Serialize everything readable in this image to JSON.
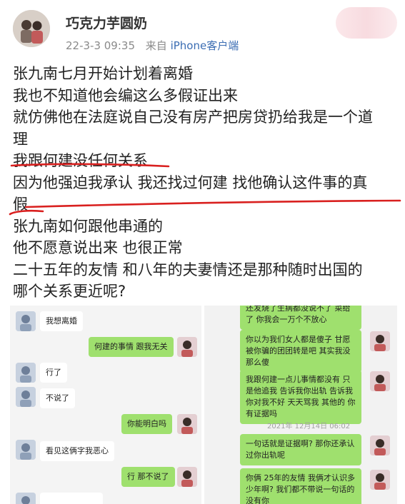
{
  "header": {
    "username": "巧克力芋圆奶",
    "datetime": "22-3-3 09:35",
    "source_prefix": "来自",
    "source": "iPhone客户端"
  },
  "post": {
    "lines": [
      "张九南七月开始计划着离婚",
      "我也不知道他会编这么多假证出来",
      "就仿佛他在法庭说自己没有房产把房贷扔给我是一个道",
      "理",
      "我跟何建没任何关系",
      "因为他强迫我承认 我还找过何建 找他确认这件事的真",
      "假",
      "张九南如何跟他串通的",
      "他不愿意说出来 也很正常",
      "二十五年的友情 和八年的夫妻情还是那种随时出国的",
      "哪个关系更近呢?"
    ]
  },
  "screenshot_left": {
    "messages": [
      {
        "side": "in",
        "text": "我想离婚"
      },
      {
        "side": "out",
        "text": "何建的事情 跟我无关"
      },
      {
        "side": "in",
        "text": "行了"
      },
      {
        "side": "in",
        "text": "不说了"
      },
      {
        "side": "out",
        "text": "你能明白吗"
      },
      {
        "side": "in",
        "text": "看见这俩字我恶心"
      },
      {
        "side": "out",
        "text": "行 那不说了"
      }
    ]
  },
  "screenshot_right": {
    "messages": [
      {
        "side": "out",
        "text": "还发烧了生病都没说不了 菜给了 你我会一万个不放心"
      },
      {
        "side": "out",
        "text": "你以为我们女人都是傻子 甘愿被你骗的团团转是吧 其实我没那么傻"
      },
      {
        "side": "out",
        "text": "我跟何建一点儿事情都没有 只是他追我 告诉我你出轨 告诉我你对我不好 天天骂我 其他的 你有证据吗"
      },
      {
        "side": "out",
        "text": "一句话就是证据啊? 那你还承认过你出轨呢"
      },
      {
        "side": "out",
        "text": "你俩 25年的友情 我俩才认识多少年啊? 我们都不带说一句话的 没有你"
      }
    ],
    "timestamp": "2021年 12月14日 06:02"
  },
  "colors": {
    "annotation_red": "#d9201f",
    "link_blue": "#3b6db3",
    "wechat_green": "#9fe06e",
    "meta_gray": "#8a8a8a"
  }
}
